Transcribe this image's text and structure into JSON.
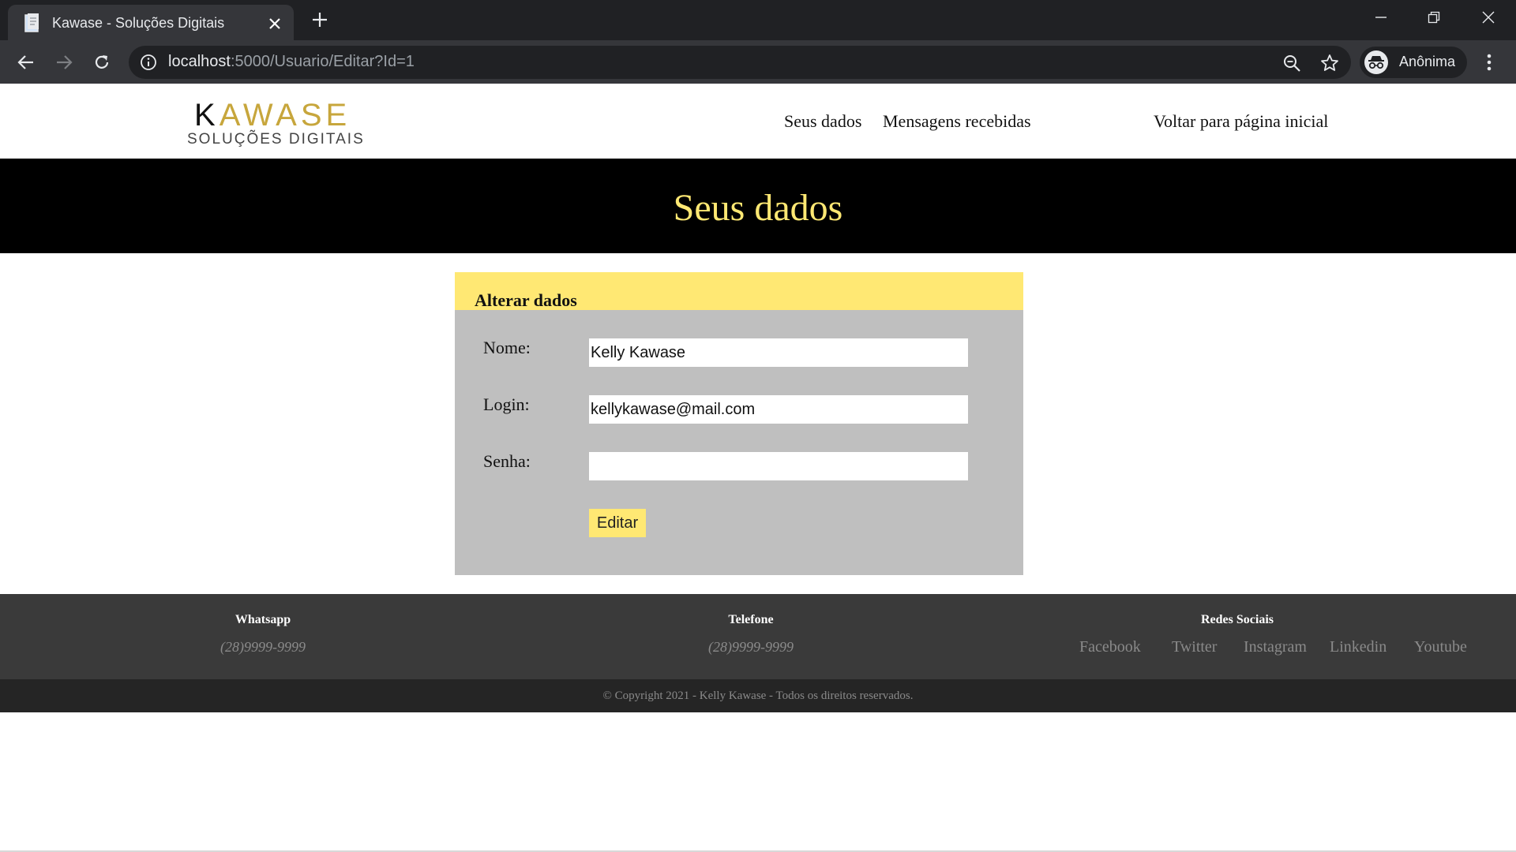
{
  "browser": {
    "tab_title": "Kawase - Soluções Digitais",
    "url_host": "localhost",
    "url_rest": ":5000/Usuario/Editar?Id=1",
    "profile_label": "Anônima",
    "icons": [
      "document-icon",
      "close-icon",
      "plus-icon",
      "minimize-icon",
      "restore-icon",
      "window-close-icon",
      "back-arrow-icon",
      "forward-arrow-icon",
      "reload-icon",
      "info-icon",
      "zoom-icon",
      "star-icon",
      "incognito-icon",
      "kebab-menu-icon"
    ]
  },
  "header": {
    "logo_main": "KAWASE",
    "logo_k": "K",
    "logo_rest": "AWASE",
    "logo_sub": "SOLUÇÕES DIGITAIS",
    "nav": {
      "seus_dados": "Seus dados",
      "mensagens": "Mensagens recebidas",
      "voltar": "Voltar para página inicial"
    }
  },
  "hero": {
    "title": "Seus dados"
  },
  "form": {
    "title": "Alterar dados",
    "nome_label": "Nome:",
    "nome_value": "Kelly Kawase",
    "login_label": "Login:",
    "login_value": "kellykawase@mail.com",
    "senha_label": "Senha:",
    "senha_value": "",
    "submit_label": "Editar"
  },
  "footer": {
    "whatsapp_heading": "Whatsapp",
    "whatsapp_value": "(28)9999-9999",
    "telefone_heading": "Telefone",
    "telefone_value": "(28)9999-9999",
    "redes_heading": "Redes Sociais",
    "social": [
      "Facebook",
      "Twitter",
      "Instagram",
      "Linkedin",
      "Youtube"
    ],
    "copyright": "© Copyright 2021 - Kelly Kawase - Todos os direitos reservados."
  },
  "colors": {
    "accent_yellow": "#ffe873",
    "logo_gold": "#c7a63c",
    "card_gray": "#bfbfbf",
    "footer_dark": "#3a3a3a",
    "copyright_dark": "#252525",
    "hero_black": "#000000"
  }
}
